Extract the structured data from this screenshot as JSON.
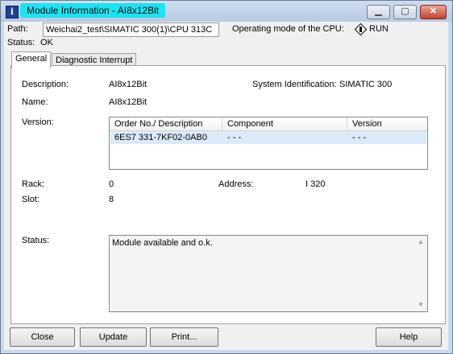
{
  "window": {
    "title": "Module Information  -  AI8x12Bit",
    "controls": [
      "minimize",
      "maximize",
      "close"
    ]
  },
  "header": {
    "path_label": "Path:",
    "path_value": "Weichai2_test\\SIMATIC 300(1)\\CPU 313C",
    "opmode_label": "Operating mode of the  CPU:",
    "opmode_value": "RUN",
    "status_label": "Status:",
    "status_value": "OK"
  },
  "tabs": [
    {
      "label": "General",
      "active": true
    },
    {
      "label": "Diagnostic Interrupt",
      "active": false
    }
  ],
  "general": {
    "description_label": "Description:",
    "description_value": "AI8x12Bit",
    "sysid_label": "System Identification:",
    "sysid_value": "SIMATIC 300",
    "name_label": "Name:",
    "name_value": "AI8x12Bit",
    "version_label": "Version:",
    "version_table": {
      "columns": [
        "Order No./ Description",
        "Component",
        "Version"
      ],
      "rows": [
        {
          "order": "6ES7 331-7KF02-0AB0",
          "component": "- - -",
          "version": "- - -"
        }
      ]
    },
    "rack_label": "Rack:",
    "rack_value": "0",
    "slot_label": "Slot:",
    "slot_value": "8",
    "address_label": "Address:",
    "address_value": "I 320",
    "status_label": "Status:",
    "status_text": "Module available and o.k."
  },
  "buttons": {
    "close": "Close",
    "update": "Update",
    "print": "Print...",
    "help": "Help"
  },
  "colors": {
    "title_highlight": "#18e4f4",
    "frame": "#c9d8ea",
    "selected_row": "#dbeaf9"
  }
}
